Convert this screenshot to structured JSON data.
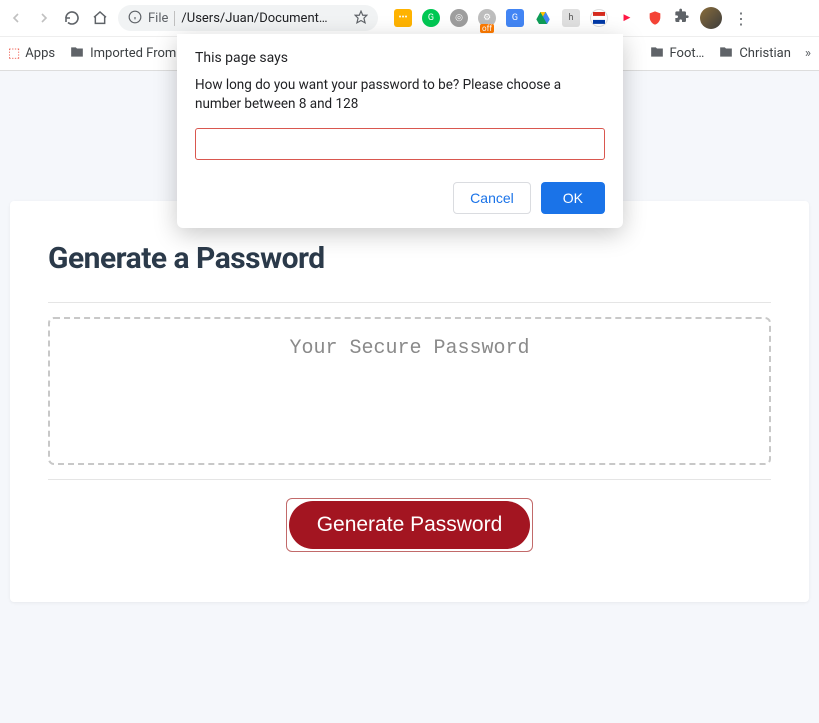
{
  "toolbar": {
    "file_label": "File",
    "url_path": "/Users/Juan/Document…"
  },
  "bookmarks": {
    "apps": "Apps",
    "imported": "Imported From F…",
    "foot": "Foot…",
    "christian": "Christian"
  },
  "dialog": {
    "title": "This page says",
    "message": "How long do you want your password to be? Please choose a number between 8 and 128",
    "cancel": "Cancel",
    "ok": "OK"
  },
  "page": {
    "heading": "Generate a Password",
    "placeholder": "Your Secure Password",
    "button": "Generate Password"
  }
}
